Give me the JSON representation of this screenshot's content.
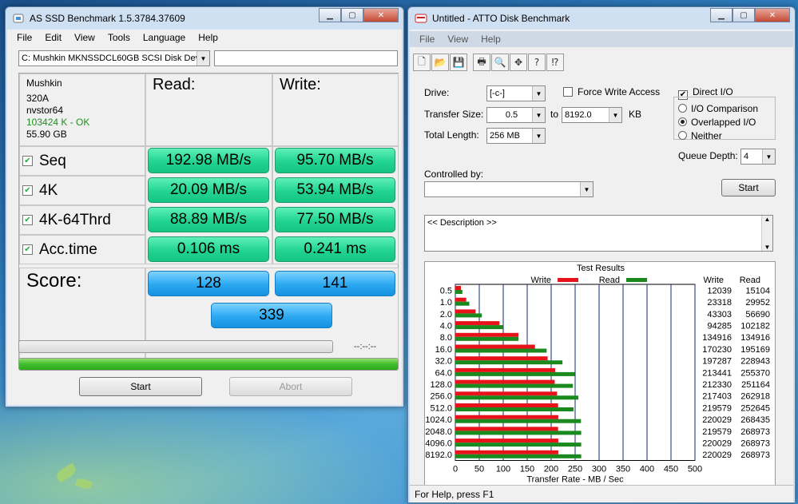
{
  "asssd": {
    "title": "AS SSD Benchmark 1.5.3784.37609",
    "menu": [
      "File",
      "Edit",
      "View",
      "Tools",
      "Language",
      "Help"
    ],
    "drive_select": "C: Mushkin MKNSSDCL60GB SCSI Disk Dev",
    "info": {
      "vendor": "Mushkin",
      "firmware": "320A",
      "driver": "nvstor64",
      "alignment": "103424 K - OK",
      "size": "55.90 GB"
    },
    "headers": {
      "read": "Read:",
      "write": "Write:"
    },
    "rows": [
      {
        "label": "Seq",
        "read": "192.98 MB/s",
        "write": "95.70 MB/s"
      },
      {
        "label": "4K",
        "read": "20.09 MB/s",
        "write": "53.94 MB/s"
      },
      {
        "label": "4K-64Thrd",
        "read": "88.89 MB/s",
        "write": "77.50 MB/s"
      },
      {
        "label": "Acc.time",
        "read": "0.106 ms",
        "write": "0.241 ms"
      }
    ],
    "score": {
      "label": "Score:",
      "read": "128",
      "write": "141",
      "total": "339"
    },
    "time": "--:--:--",
    "progress": 1.0,
    "buttons": {
      "start": "Start",
      "abort": "Abort"
    }
  },
  "atto": {
    "title": "Untitled - ATTO Disk Benchmark",
    "menu": [
      "File",
      "View",
      "Help"
    ],
    "toolbar_icons": [
      "new-icon",
      "open-icon",
      "save-icon",
      "print-icon",
      "print-preview-icon",
      "move-icon",
      "help-icon",
      "context-help-icon"
    ],
    "drive_label": "Drive:",
    "drive_value": "[-c-]",
    "force_write": "Force Write Access",
    "direct_io": "Direct I/O",
    "transfer_label": "Transfer Size:",
    "transfer_from": "0.5",
    "to_label": "to",
    "transfer_to": "8192.0",
    "kb_label": "KB",
    "total_label": "Total Length:",
    "total_value": "256 MB",
    "radio_io": [
      "I/O Comparison",
      "Overlapped I/O",
      "Neither"
    ],
    "radio_selected": 1,
    "queue_label": "Queue Depth:",
    "queue_value": "4",
    "controlled_label": "Controlled by:",
    "controlled_value": "",
    "start_label": "Start",
    "description": "<< Description >>",
    "status": "For Help, press F1",
    "colors": {
      "write": "#e8121a",
      "read": "#1a8a1e"
    }
  },
  "chart_data": {
    "type": "bar",
    "title": "Test Results",
    "xlabel": "Transfer Rate - MB / Sec",
    "ylabel": "",
    "xlim": [
      0,
      500
    ],
    "xticks": [
      "0",
      "50",
      "100",
      "150",
      "200",
      "250",
      "300",
      "350",
      "400",
      "450",
      "500"
    ],
    "legend": [
      "Write",
      "Read"
    ],
    "col_headers": [
      "Write",
      "Read"
    ],
    "categories": [
      "0.5",
      "1.0",
      "2.0",
      "4.0",
      "8.0",
      "16.0",
      "32.0",
      "64.0",
      "128.0",
      "256.0",
      "512.0",
      "1024.0",
      "2048.0",
      "4096.0",
      "8192.0"
    ],
    "series": [
      {
        "name": "Write",
        "values": [
          12039,
          23318,
          43303,
          94285,
          134916,
          170230,
          197287,
          213441,
          212330,
          217403,
          219579,
          220029,
          219579,
          220029,
          220029
        ]
      },
      {
        "name": "Read",
        "values": [
          15104,
          29952,
          56690,
          102182,
          134916,
          195169,
          228943,
          255370,
          251164,
          262918,
          252645,
          268435,
          268973,
          268973,
          268973
        ]
      }
    ]
  }
}
